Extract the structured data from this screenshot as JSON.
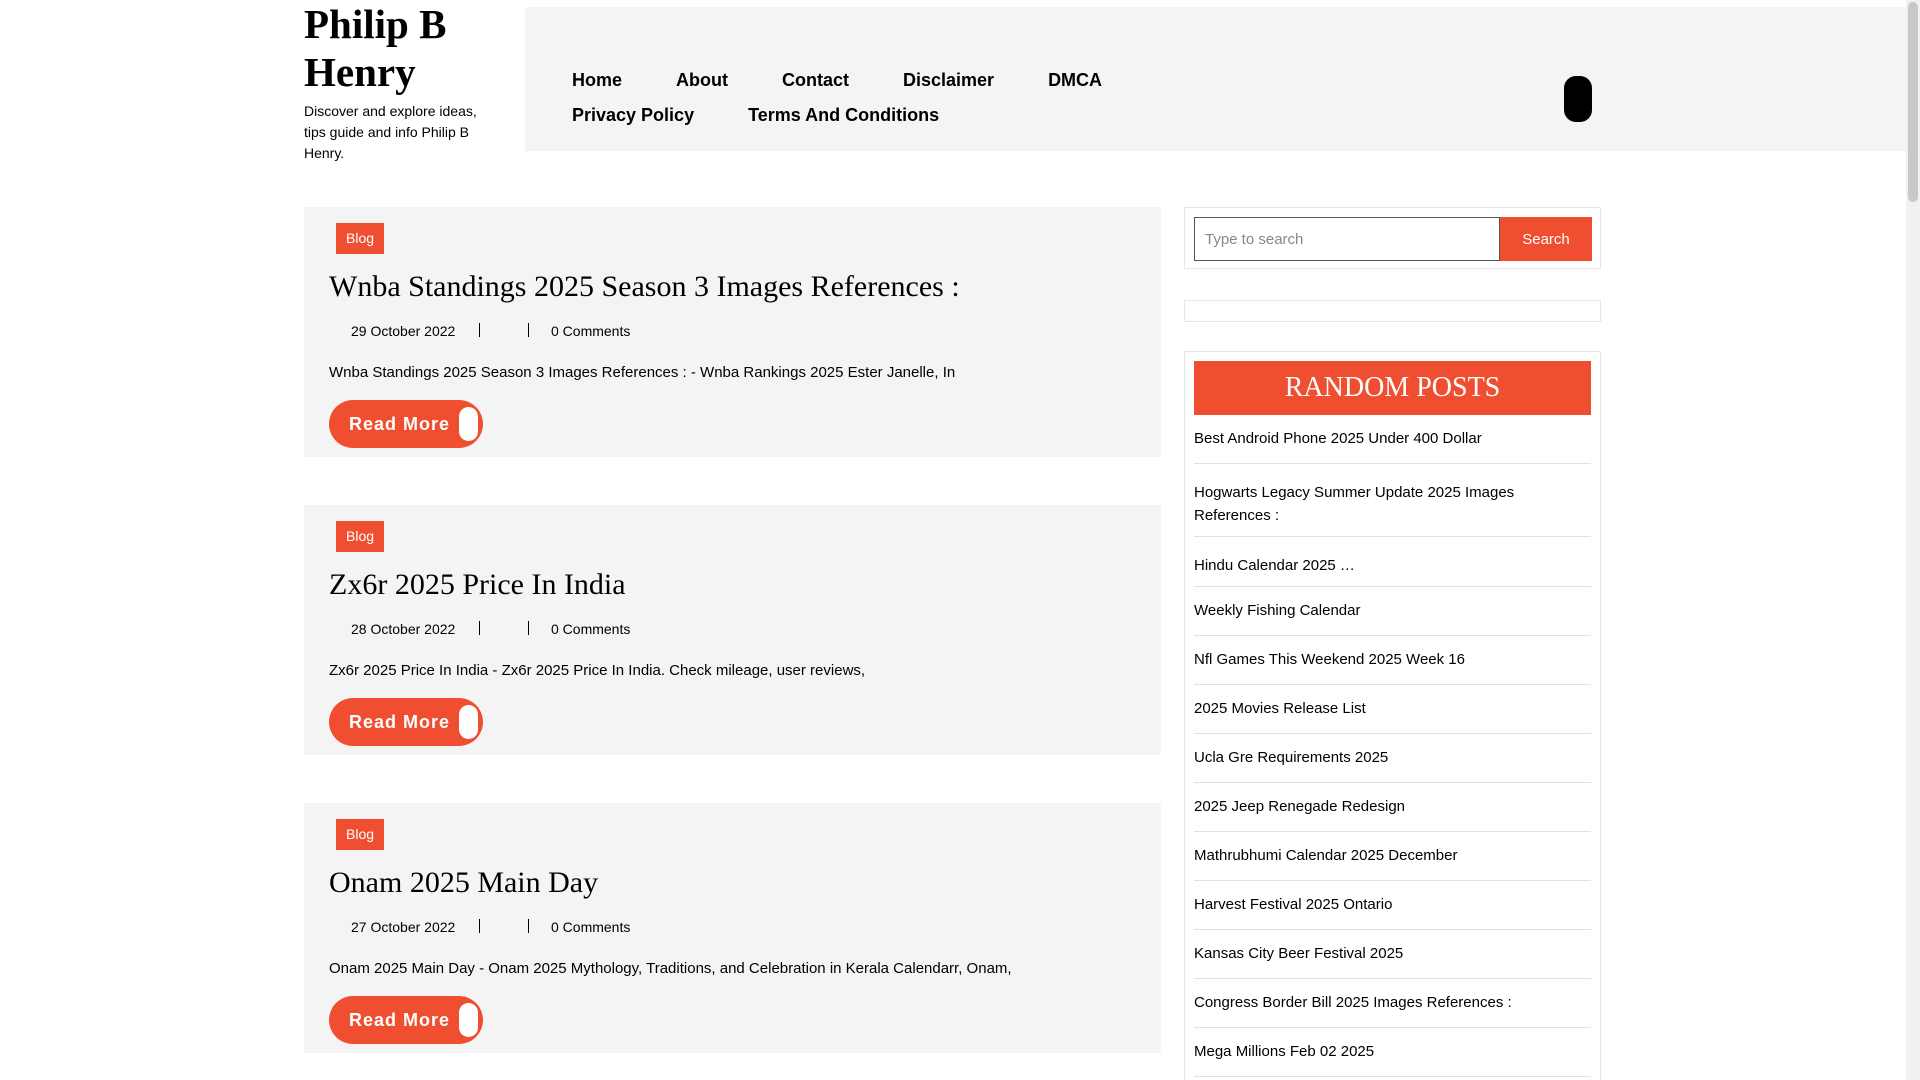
{
  "site": {
    "title": "Philip B Henry",
    "title_line1": "Philip B",
    "title_line2": "Henry",
    "description": "Discover and explore ideas, tips guide and info Philip B Henry."
  },
  "nav": {
    "items": [
      {
        "label": "Home"
      },
      {
        "label": "About"
      },
      {
        "label": "Contact"
      },
      {
        "label": "Disclaimer"
      },
      {
        "label": "DMCA"
      },
      {
        "label": "Privacy Policy"
      },
      {
        "label": "Terms And Conditions"
      }
    ]
  },
  "posts": [
    {
      "category": "Blog",
      "title": "Wnba Standings 2025 Season 3 Images References :",
      "date": "29 October 2022",
      "comments": "0 Comments",
      "excerpt": "Wnba Standings 2025 Season 3 Images References : - Wnba Rankings 2025 Ester Janelle, In",
      "read_more": "Read More"
    },
    {
      "category": "Blog",
      "title": "Zx6r 2025 Price In India",
      "date": "28 October 2022",
      "comments": "0 Comments",
      "excerpt": "Zx6r 2025 Price In India - Zx6r 2025 Price In India. Check mileage, user reviews,",
      "read_more": "Read More"
    },
    {
      "category": "Blog",
      "title": "Onam 2025 Main Day",
      "date": "27 October 2022",
      "comments": "0 Comments",
      "excerpt": "Onam 2025 Main Day - Onam 2025 Mythology, Traditions, and Celebration in Kerala Calendarr, Onam,",
      "read_more": "Read More"
    }
  ],
  "search": {
    "placeholder": "Type to search",
    "value": "",
    "button_label": "Search"
  },
  "random_posts": {
    "heading": "RANDOM POSTS",
    "items": [
      {
        "label": "Best Android Phone 2025 Under 400 Dollar"
      },
      {
        "label": "Hogwarts Legacy Summer Update 2025 Images References :"
      },
      {
        "label": "Hindu Calendar 2025 …"
      },
      {
        "label": "Weekly Fishing Calendar"
      },
      {
        "label": "Nfl Games This Weekend 2025 Week 16"
      },
      {
        "label": "2025 Movies Release List"
      },
      {
        "label": "Ucla Gre Requirements 2025"
      },
      {
        "label": "2025 Jeep Renegade Redesign"
      },
      {
        "label": "Mathrubhumi Calendar 2025 December"
      },
      {
        "label": "Harvest Festival 2025 Ontario"
      },
      {
        "label": "Kansas City Beer Festival 2025"
      },
      {
        "label": "Congress Border Bill 2025 Images References :"
      },
      {
        "label": "Mega Millions Feb 02 2025"
      }
    ]
  },
  "colors": {
    "accent": "#f04e30",
    "panel_bg": "#f4f4f4",
    "text": "#000000"
  }
}
